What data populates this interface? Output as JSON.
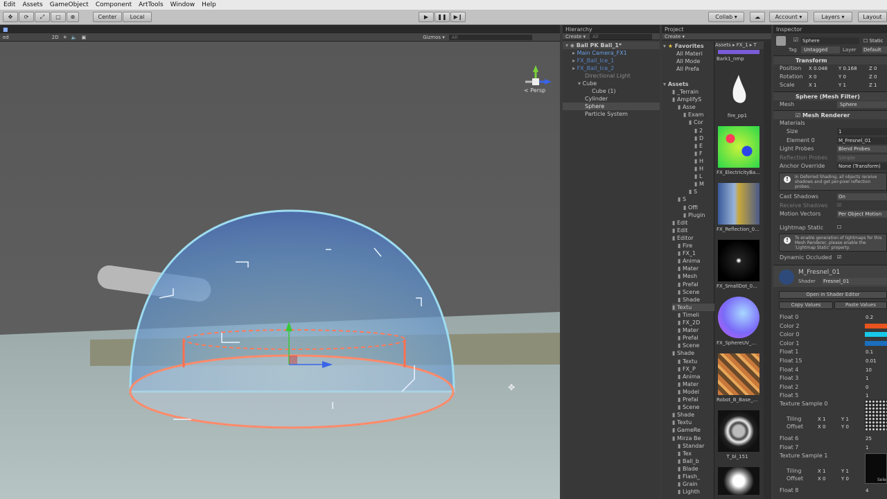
{
  "menu": [
    "Edit",
    "Assets",
    "GameObject",
    "Component",
    "ArtTools",
    "Window",
    "Help"
  ],
  "toolbar": {
    "center_label": "Center",
    "local_label": "Local",
    "collab_label": "Collab ▾",
    "account_label": "Account ▾",
    "layers_label": "Layers ▾",
    "layout_label": "Layout"
  },
  "scene": {
    "tab_label": "ed",
    "mode_2d": "2D",
    "gizmos_label": "Gizmos ▾",
    "search_placeholder": "All",
    "persp_label": "< Persp"
  },
  "hierarchy": {
    "tab_label": "Hierarchy",
    "create_label": "Create ▾",
    "search_placeholder": "All",
    "scene_name": "Ball PK Ball_1*",
    "items": [
      {
        "label": "Main Camera_FX1",
        "color": "#6aa0e8"
      },
      {
        "label": "FX_Ball_Ice_1",
        "color": "#5a86c8"
      },
      {
        "label": "FX_Ball_Ice_2",
        "color": "#5a86c8"
      },
      {
        "label": "Directional Light",
        "color": "#8a8a8a"
      },
      {
        "label": "Cube",
        "color": "#c8c8c8"
      },
      {
        "label": "Cube (1)",
        "color": "#c8c8c8"
      },
      {
        "label": "Cylinder",
        "color": "#c8c8c8"
      },
      {
        "label": "Sphere",
        "color": "#e0e0e0"
      },
      {
        "label": "Particle System",
        "color": "#c8c8c8"
      }
    ]
  },
  "project": {
    "tab_label": "Project",
    "create_label": "Create ▾",
    "favorites": {
      "label": "Favorites",
      "items": [
        "All Materi",
        "All Mode",
        "All Prefa"
      ]
    },
    "assets_label": "Assets",
    "tree": [
      "_Terrain",
      "AmplifyS",
      "Asse",
      "Exam",
      "Cor",
      "2",
      "D",
      "E",
      "F",
      "H",
      "H",
      "L",
      "M",
      "S",
      "S",
      "Offi",
      "Plugin",
      "Edit",
      "Edit",
      "Editor",
      "Fire",
      "FX_1",
      "Anima",
      "Mater",
      "Mesh",
      "Prefal",
      "Scene",
      "Shade",
      "Textu",
      "Timeli",
      "FX_2D",
      "Mater",
      "Prefal",
      "Scene",
      "Shade",
      "Textu",
      "FX_P",
      "Anima",
      "Mater",
      "Model",
      "Prefal",
      "Scene",
      "Shade",
      "Textu",
      "GameRe",
      "Mirza Be",
      "Standar",
      "Tex",
      "Ball_b",
      "Blade",
      "Flash_",
      "Grain",
      "Lighth"
    ],
    "breadcrumb": [
      "Assets",
      "FX_1",
      "T"
    ],
    "thumbs": [
      "Bark1_nmp",
      "fire_pp1",
      "FX_ElectricityBa...",
      "FX_Reflection_0...",
      "FX_SmallDot_0...",
      "FX_SphereUV_...",
      "Robot_B_Base_...",
      "T_bl_151",
      ""
    ]
  },
  "inspector": {
    "tab_label": "Inspector",
    "object_name": "Sphere",
    "static_label": "Static",
    "tag_label": "Tag",
    "tag_value": "Untagged",
    "layer_label": "Layer",
    "layer_value": "Default",
    "transform": {
      "title": "Transform",
      "position": {
        "label": "Position",
        "x": "X 0.048",
        "y": "Y 0.168",
        "z": "Z 0"
      },
      "rotation": {
        "label": "Rotation",
        "x": "X 0",
        "y": "Y 0",
        "z": "Z 0"
      },
      "scale": {
        "label": "Scale",
        "x": "X 1",
        "y": "Y 1",
        "z": "Z 1"
      }
    },
    "mesh_filter": {
      "title": "Sphere (Mesh Filter)",
      "mesh_label": "Mesh",
      "mesh_value": "Sphere"
    },
    "mesh_renderer": {
      "title": "Mesh Renderer",
      "materials": "Materials",
      "size_label": "Size",
      "size_value": "1",
      "element0_label": "Element 0",
      "element0_value": "M_Fresnel_01",
      "light_probes_label": "Light Probes",
      "light_probes_value": "Blend Probes",
      "refl_probes_label": "Reflection Probes",
      "refl_probes_value": "Simple",
      "anchor_label": "Anchor Override",
      "anchor_value": "None (Transform)",
      "deferred_note": "In Deferred Shading, all objects receive shadows and get per-pixel reflection probes.",
      "cast_shadows_label": "Cast Shadows",
      "cast_shadows_value": "On",
      "receive_shadows_label": "Receive Shadows",
      "motion_vectors_label": "Motion Vectors",
      "motion_vectors_value": "Per Object Motion",
      "lightmap_static_label": "Lightmap Static",
      "lightmap_note": "To enable generation of lightmaps for this Mesh Renderer, please enable the 'Lightmap Static' property.",
      "dynamic_occluded_label": "Dynamic Occluded"
    },
    "material": {
      "name": "M_Fresnel_01",
      "shader_label": "Shader",
      "shader_value": "Fresnel_01",
      "open_editor": "Open in Shader Editor",
      "copy_values": "Copy Values",
      "paste_values": "Paste Values",
      "props": [
        {
          "label": "Float 0",
          "value": "0.2"
        },
        {
          "label": "Color 2",
          "color": "#e8541e"
        },
        {
          "label": "Color 0",
          "color": "#18c8e8"
        },
        {
          "label": "Color 1",
          "color": "#1a6fc0"
        },
        {
          "label": "Float 1",
          "value": "0.1"
        },
        {
          "label": "Float 15",
          "value": "0.01"
        },
        {
          "label": "Float 4",
          "value": "10"
        },
        {
          "label": "Float 3",
          "value": "1"
        },
        {
          "label": "Float 2",
          "value": "0"
        },
        {
          "label": "Float 5",
          "value": "1"
        }
      ],
      "tex0_label": "Texture Sample 0",
      "tiling_label": "Tiling",
      "offset_label": "Offset",
      "tiling_x": "X 1",
      "tiling_y": "Y 1",
      "offset_x": "X 0",
      "offset_y": "Y 0",
      "props2": [
        {
          "label": "Float 6",
          "value": "25"
        },
        {
          "label": "Float 7",
          "value": "1"
        }
      ],
      "tex1_label": "Texture Sample 1",
      "float8_label": "Float 8",
      "float8_value": "4",
      "select_label": "Sele"
    }
  }
}
